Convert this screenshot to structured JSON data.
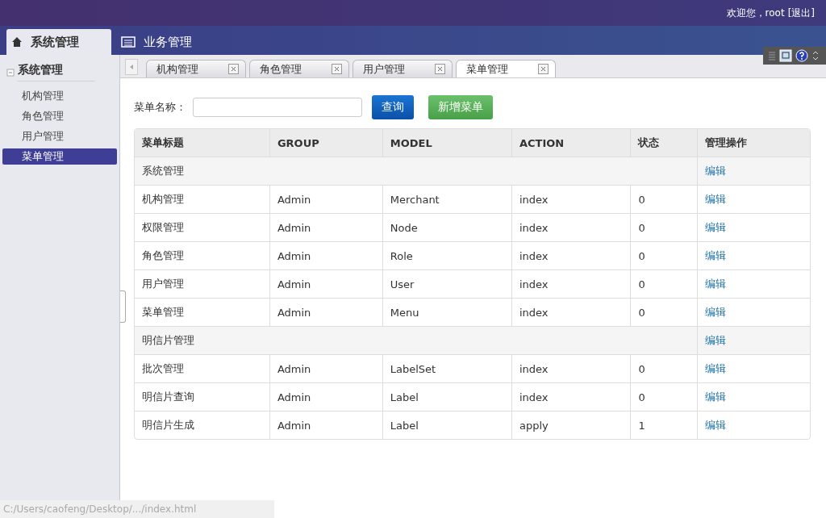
{
  "top_bar": {
    "welcome": "欢迎您，root",
    "logout": "[退出]"
  },
  "nav_tabs": [
    {
      "label": "系统管理",
      "selected": true
    },
    {
      "label": "业务管理",
      "selected": false
    }
  ],
  "sidebar": {
    "title": "系统管理",
    "items": [
      {
        "label": "机构管理",
        "selected": false
      },
      {
        "label": "角色管理",
        "selected": false
      },
      {
        "label": "用户管理",
        "selected": false
      },
      {
        "label": "菜单管理",
        "selected": true
      }
    ]
  },
  "page_tabs": [
    {
      "label": "机构管理",
      "selected": false
    },
    {
      "label": "角色管理",
      "selected": false
    },
    {
      "label": "用户管理",
      "selected": false
    },
    {
      "label": "菜单管理",
      "selected": true
    }
  ],
  "search": {
    "label": "菜单名称：",
    "query_button": "查询",
    "add_button": "新增菜单"
  },
  "table": {
    "columns": [
      "菜单标题",
      "GROUP",
      "MODEL",
      "ACTION",
      "状态",
      "管理操作"
    ],
    "rows": [
      {
        "kind": "group",
        "cells": [
          {
            "text": "系统管理",
            "colspan": 5
          },
          "编辑"
        ]
      },
      {
        "kind": "item",
        "cells": [
          "机构管理",
          "Admin",
          "Merchant",
          "index",
          "0",
          "编辑"
        ]
      },
      {
        "kind": "item",
        "cells": [
          "权限管理",
          "Admin",
          "Node",
          "index",
          "0",
          "编辑"
        ]
      },
      {
        "kind": "item",
        "cells": [
          "角色管理",
          "Admin",
          "Role",
          "index",
          "0",
          "编辑"
        ]
      },
      {
        "kind": "item",
        "cells": [
          "用户管理",
          "Admin",
          "User",
          "index",
          "0",
          "编辑"
        ]
      },
      {
        "kind": "item",
        "cells": [
          "菜单管理",
          "Admin",
          "Menu",
          "index",
          "0",
          "编辑"
        ]
      },
      {
        "kind": "group",
        "cells": [
          {
            "text": "明信片管理",
            "colspan": 5
          },
          "编辑"
        ]
      },
      {
        "kind": "item",
        "cells": [
          "批次管理",
          "Admin",
          "LabelSet",
          "index",
          "0",
          "编辑"
        ]
      },
      {
        "kind": "item",
        "cells": [
          "明信片查询",
          "Admin",
          "Label",
          "index",
          "0",
          "编辑"
        ]
      },
      {
        "kind": "item",
        "cells": [
          "明信片生成",
          "Admin",
          "Label",
          "apply",
          "1",
          "编辑"
        ]
      }
    ]
  },
  "status_bar": "C:/Users/caofeng/Desktop/.../index.html"
}
